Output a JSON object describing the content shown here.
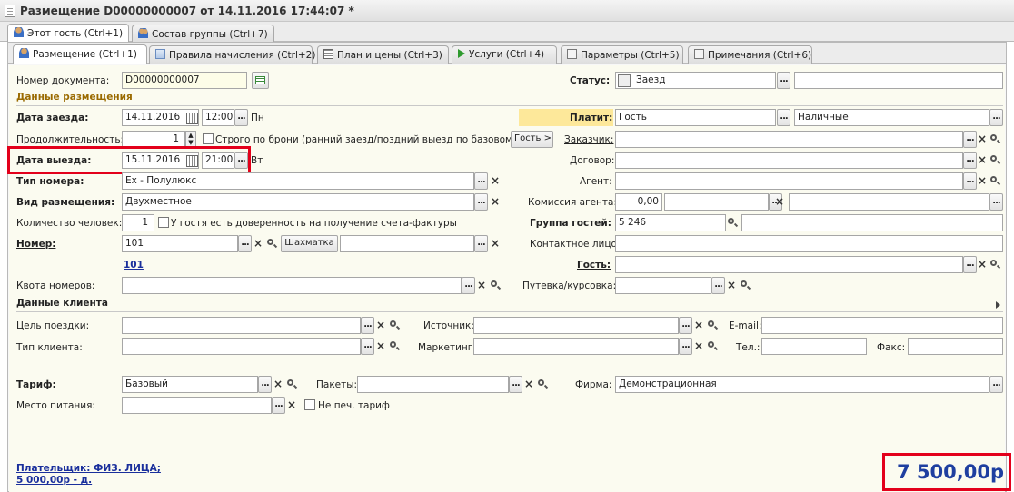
{
  "window": {
    "title": "Размещение D00000000007 от 14.11.2016 17:44:07 *"
  },
  "top_tabs": [
    {
      "label": "Этот гость (Ctrl+1)",
      "icon": "user-icon"
    },
    {
      "label": "Состав группы (Ctrl+7)",
      "icon": "group-icon"
    }
  ],
  "sub_tabs": [
    {
      "label": "Размещение (Ctrl+1)",
      "icon": "user-icon"
    },
    {
      "label": "Правила начисления (Ctrl+2)",
      "icon": "rules-icon"
    },
    {
      "label": "План и цены (Ctrl+3)",
      "icon": "table-icon"
    },
    {
      "label": "Услуги (Ctrl+4)",
      "icon": "play-icon"
    },
    {
      "label": "Параметры (Ctrl+5)",
      "icon": "params-icon"
    },
    {
      "label": "Примечания (Ctrl+6)",
      "icon": "notes-icon"
    }
  ],
  "form": {
    "doc_number_label": "Номер документа:",
    "doc_number": "D00000000007",
    "status_label": "Статус:",
    "status_value": "Заезд",
    "section_placement": "Данные размещения",
    "checkin_label": "Дата заезда:",
    "checkin_date": "14.11.2016",
    "checkin_time": "12:00",
    "checkin_day": "Пн",
    "pays_label": "Платит:",
    "pays_value": "Гость",
    "payment_method": "Наличные",
    "duration_label": "Продолжительность:",
    "duration_value": "1",
    "strict_booking_label": "Строго по брони (ранний заезд/поздний выезд по базовому ...",
    "guest_button": "Гость >",
    "customer_label": "Заказчик:",
    "checkout_label": "Дата выезда:",
    "checkout_date": "15.11.2016",
    "checkout_time": "21:00",
    "checkout_day": "Вт",
    "contract_label": "Договор:",
    "room_type_label": "Тип номера:",
    "room_type_value": "Ex - Полулюкс",
    "agent_label": "Агент:",
    "accommodation_label": "Вид размещения:",
    "accommodation_value": "Двухместное",
    "agent_commission_label": "Комиссия агента:",
    "agent_commission_value": "0,00",
    "people_count_label": "Количество человек:",
    "people_count_value": "1",
    "power_of_attorney_label": "У гостя есть доверенность на получение счета-фактуры",
    "guest_group_label": "Группа гостей:",
    "guest_group_value": "5 246",
    "room_label": "Номер:",
    "room_value": "101",
    "chess_button": "Шахматка",
    "contact_label": "Контактное лицо:",
    "room_link": "101",
    "guest_label": "Гость:",
    "quota_label": "Квота номеров:",
    "voucher_label": "Путевка/курсовка:"
  },
  "client": {
    "section": "Данные клиента",
    "trip_purpose_label": "Цель поездки:",
    "source_label": "Источник:",
    "email_label": "E-mail:",
    "client_type_label": "Тип клиента:",
    "marketing_label": "Маркетинг:",
    "phone_label": "Тел.:",
    "fax_label": "Факс:"
  },
  "tariff": {
    "tariff_label": "Тариф:",
    "tariff_value": "Базовый",
    "packages_label": "Пакеты:",
    "firm_label": "Фирма:",
    "firm_value": "Демонстрационная",
    "meal_label": "Место питания:",
    "no_print_label": "Не печ. тариф"
  },
  "footer": {
    "payer_link": "Плательщик: ФИЗ. ЛИЦА;",
    "payer_amount": "5 000,00р - д.",
    "total": "7 500,00р"
  },
  "colors": {
    "highlight": "#e3001b",
    "total_text": "#1f3fa0",
    "section_title": "#9a6a00"
  }
}
